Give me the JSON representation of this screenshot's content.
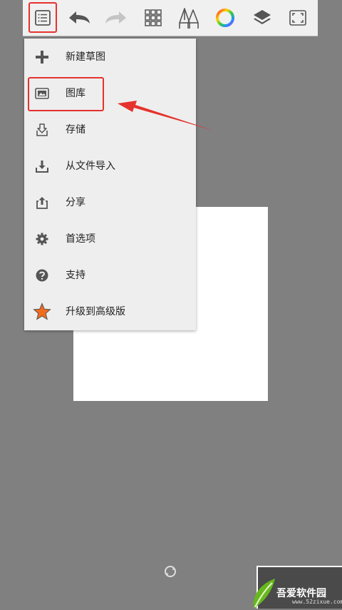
{
  "toolbar": {
    "buttons": [
      {
        "name": "menu-list-icon"
      },
      {
        "name": "undo-icon"
      },
      {
        "name": "redo-icon"
      },
      {
        "name": "brush-grid-icon"
      },
      {
        "name": "pen-tools-icon"
      },
      {
        "name": "color-wheel-icon"
      },
      {
        "name": "layers-icon"
      },
      {
        "name": "fullscreen-icon"
      }
    ],
    "highlight_color": "#e5322d"
  },
  "menu": {
    "items": [
      {
        "label": "新建草图",
        "icon": "plus-icon"
      },
      {
        "label": "图库",
        "icon": "gallery-icon"
      },
      {
        "label": "存储",
        "icon": "save-icon"
      },
      {
        "label": "从文件导入",
        "icon": "import-icon"
      },
      {
        "label": "分享",
        "icon": "share-icon"
      },
      {
        "label": "首选项",
        "icon": "gear-icon"
      },
      {
        "label": "支持",
        "icon": "help-icon"
      },
      {
        "label": "升级到高级版",
        "icon": "star-icon"
      }
    ],
    "highlighted_item": "图库"
  },
  "watermark": {
    "title": "吾爱软件园",
    "url": "www.52zixue.com"
  },
  "colors": {
    "background": "#808080",
    "canvas": "#ffffff",
    "menu_bg": "#eeeeee",
    "annotation_red": "#e5322d",
    "star": "#f26b1d"
  }
}
